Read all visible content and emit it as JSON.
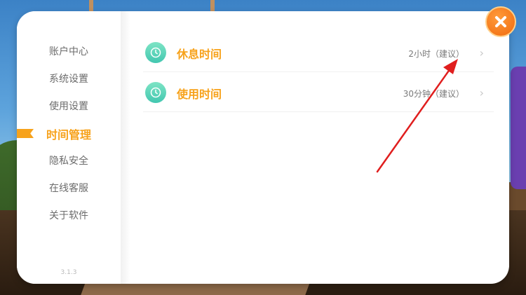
{
  "sidebar": {
    "items": [
      {
        "label": "账户中心"
      },
      {
        "label": "系统设置"
      },
      {
        "label": "使用设置"
      },
      {
        "label": "时间管理",
        "active": true
      },
      {
        "label": "隐私安全"
      },
      {
        "label": "在线客服"
      },
      {
        "label": "关于软件"
      }
    ],
    "version": "3.1.3"
  },
  "settings": {
    "rows": [
      {
        "title": "休息时间",
        "value": "2小时（建议）",
        "icon": "clock-icon"
      },
      {
        "title": "使用时间",
        "value": "30分钟（建议）",
        "icon": "clock-icon"
      }
    ]
  },
  "colors": {
    "accent": "#f7a21b",
    "icon_teal": "#42c7b0",
    "close": "#f06a0e",
    "annotation_arrow": "#e01e1e"
  }
}
